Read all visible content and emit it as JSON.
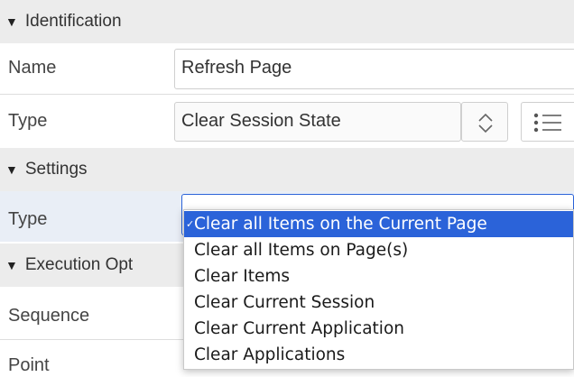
{
  "sections": {
    "identification": {
      "title": "Identification"
    },
    "settings": {
      "title": "Settings"
    },
    "execution": {
      "title": "Execution Opt"
    }
  },
  "identification": {
    "name_label": "Name",
    "name_value": "Refresh Page",
    "type_label": "Type",
    "type_value": "Clear Session State"
  },
  "settings": {
    "type_label": "Type",
    "type_value": ""
  },
  "execution": {
    "sequence_label": "Sequence",
    "point_label": "Point"
  },
  "dropdown": {
    "check_glyph": "✓",
    "options": [
      "Clear all Items on the Current Page",
      "Clear all Items on Page(s)",
      "Clear Items",
      "Clear Current Session",
      "Clear Current Application",
      "Clear Applications"
    ],
    "selected_index": 0
  },
  "colors": {
    "selection": "#2b63d9",
    "section_background": "#ececec"
  },
  "icons": {
    "collapse": "triangle-down-icon",
    "spinner": "up-down-chevron-icon",
    "list": "list-icon"
  }
}
